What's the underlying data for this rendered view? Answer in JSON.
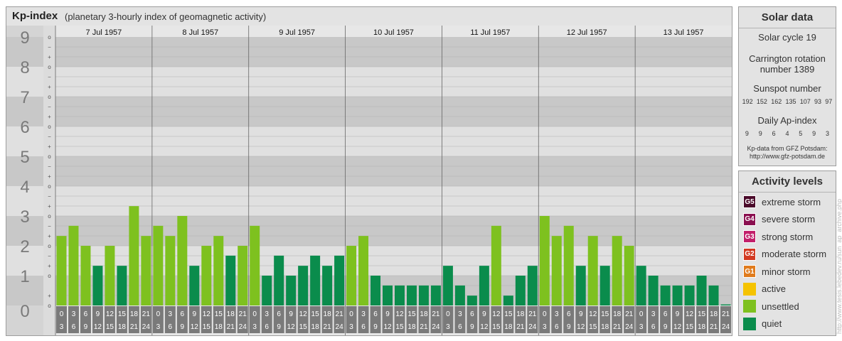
{
  "header": {
    "title": "Kp-index",
    "subtitle": "(planetary 3-hourly index of geomagnetic activity)"
  },
  "colors": {
    "quiet": "#0a8c4c",
    "unsettled": "#7ec11f",
    "active": "#f5c300",
    "G1": "#e07b1c",
    "G2": "#d23a22",
    "G3": "#c21f6a",
    "G4": "#8a0f4f",
    "G5": "#4a0a2a",
    "band_dark": "#c8c8c8",
    "band_light": "#e0e0e0",
    "grid": "#b0b0b0",
    "axis_label": "#7a7a7a",
    "time_box": "#7a7a7a"
  },
  "chart_data": {
    "type": "bar",
    "title": "Kp-index",
    "ylim": [
      0,
      9
    ],
    "yticks": [
      "0",
      "1",
      "2",
      "3",
      "4",
      "5",
      "6",
      "7",
      "8",
      "9"
    ],
    "subtick_marks": [
      "o",
      "+",
      "−"
    ],
    "days": [
      "7 Jul 1957",
      "8 Jul 1957",
      "9 Jul 1957",
      "10 Jul 1957",
      "11 Jul 1957",
      "12 Jul 1957",
      "13 Jul 1957"
    ],
    "interval_start": [
      "0",
      "3",
      "6",
      "9",
      "12",
      "15",
      "18",
      "21"
    ],
    "interval_end": [
      "3",
      "6",
      "9",
      "12",
      "15",
      "18",
      "21",
      "24"
    ],
    "values": [
      2.33,
      2.67,
      2.0,
      1.33,
      2.0,
      1.33,
      3.33,
      2.33,
      2.67,
      2.33,
      3.0,
      1.33,
      2.0,
      2.33,
      1.67,
      2.0,
      2.67,
      1.0,
      1.67,
      1.0,
      1.33,
      1.67,
      1.33,
      1.67,
      2.0,
      2.33,
      1.0,
      0.67,
      0.67,
      0.67,
      0.67,
      0.67,
      1.33,
      0.67,
      0.33,
      1.33,
      2.67,
      0.33,
      1.0,
      1.33,
      3.0,
      2.33,
      2.67,
      1.33,
      2.33,
      1.33,
      2.33,
      2.0,
      1.33,
      1.0,
      0.67,
      0.67,
      0.67,
      1.0,
      0.67,
      0.0
    ],
    "category_thresholds": {
      "unsettled": 2.0,
      "active": 4.0
    }
  },
  "solar": {
    "title": "Solar data",
    "cycle": "Solar cycle 19",
    "carrington_line1": "Carrington rotation",
    "carrington_line2": "number 1389",
    "sunspot_label": "Sunspot number",
    "sunspot_values": [
      "192",
      "152",
      "162",
      "135",
      "107",
      "93",
      "97"
    ],
    "ap_label": "Daily Ap-index",
    "ap_values": [
      "9",
      "9",
      "6",
      "4",
      "5",
      "9",
      "3"
    ],
    "source_line1": "Kp-data from GFZ Potsdam:",
    "source_line2": "http://www.gfz-potsdam.de"
  },
  "activity": {
    "title": "Activity levels",
    "levels": [
      {
        "code": "G5",
        "label": "extreme storm",
        "color": "#4a0a2a"
      },
      {
        "code": "G4",
        "label": "severe storm",
        "color": "#8a0f4f"
      },
      {
        "code": "G3",
        "label": "strong storm",
        "color": "#c21f6a"
      },
      {
        "code": "G2",
        "label": "moderate storm",
        "color": "#d23a22"
      },
      {
        "code": "G1",
        "label": "minor storm",
        "color": "#e07b1c"
      },
      {
        "code": "",
        "label": "active",
        "color": "#f5c300"
      },
      {
        "code": "",
        "label": "unsettled",
        "color": "#7ec11f"
      },
      {
        "code": "",
        "label": "quiet",
        "color": "#0a8c4c"
      }
    ]
  },
  "credit": "http://www.tesis.lebedev.ru/sun_ap_archive.php"
}
